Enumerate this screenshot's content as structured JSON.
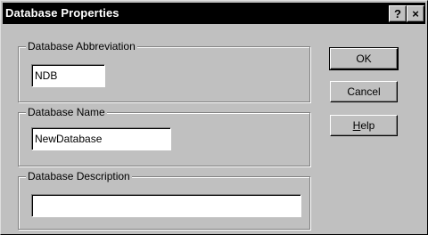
{
  "dialog": {
    "title": "Database Properties",
    "help_glyph": "?",
    "close_glyph": "×"
  },
  "groups": {
    "abbreviation": {
      "label": "Database Abbreviation",
      "value": "NDB"
    },
    "name": {
      "label": "Database Name",
      "value": "NewDatabase"
    },
    "description": {
      "label": "Database Description",
      "value": ""
    }
  },
  "buttons": {
    "ok": "OK",
    "cancel": "Cancel",
    "help_mnemonic": "H",
    "help_rest": "elp"
  },
  "colors": {
    "face": "#c0c0c0",
    "titlebar": "#000000",
    "field": "#ffffff"
  }
}
